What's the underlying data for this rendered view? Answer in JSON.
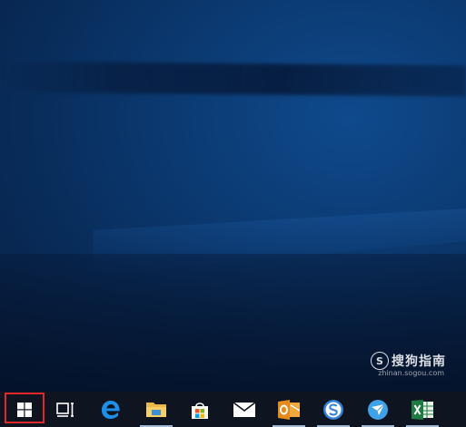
{
  "watermark": {
    "logo_letter": "S",
    "text": "搜狗指南",
    "url": "zhinan.sogou.com"
  },
  "taskbar": {
    "items": [
      {
        "name": "start",
        "icon": "windows-logo-icon",
        "running": false,
        "highlighted": true
      },
      {
        "name": "task-view",
        "icon": "task-view-icon",
        "running": false
      },
      {
        "name": "edge",
        "icon": "edge-icon",
        "running": false
      },
      {
        "name": "file-explorer",
        "icon": "folder-icon",
        "running": true
      },
      {
        "name": "store",
        "icon": "store-bag-icon",
        "running": false
      },
      {
        "name": "mail",
        "icon": "mail-envelope-icon",
        "running": false
      },
      {
        "name": "outlook",
        "icon": "outlook-icon",
        "running": true
      },
      {
        "name": "sogou-browser",
        "icon": "sogou-s-icon",
        "running": true
      },
      {
        "name": "app-bird",
        "icon": "bird-app-icon",
        "running": true
      },
      {
        "name": "excel",
        "icon": "excel-icon",
        "running": true
      }
    ]
  },
  "colors": {
    "highlight": "#e0282a",
    "taskbar": "#0e1520",
    "desktop": "#0b3a72"
  }
}
